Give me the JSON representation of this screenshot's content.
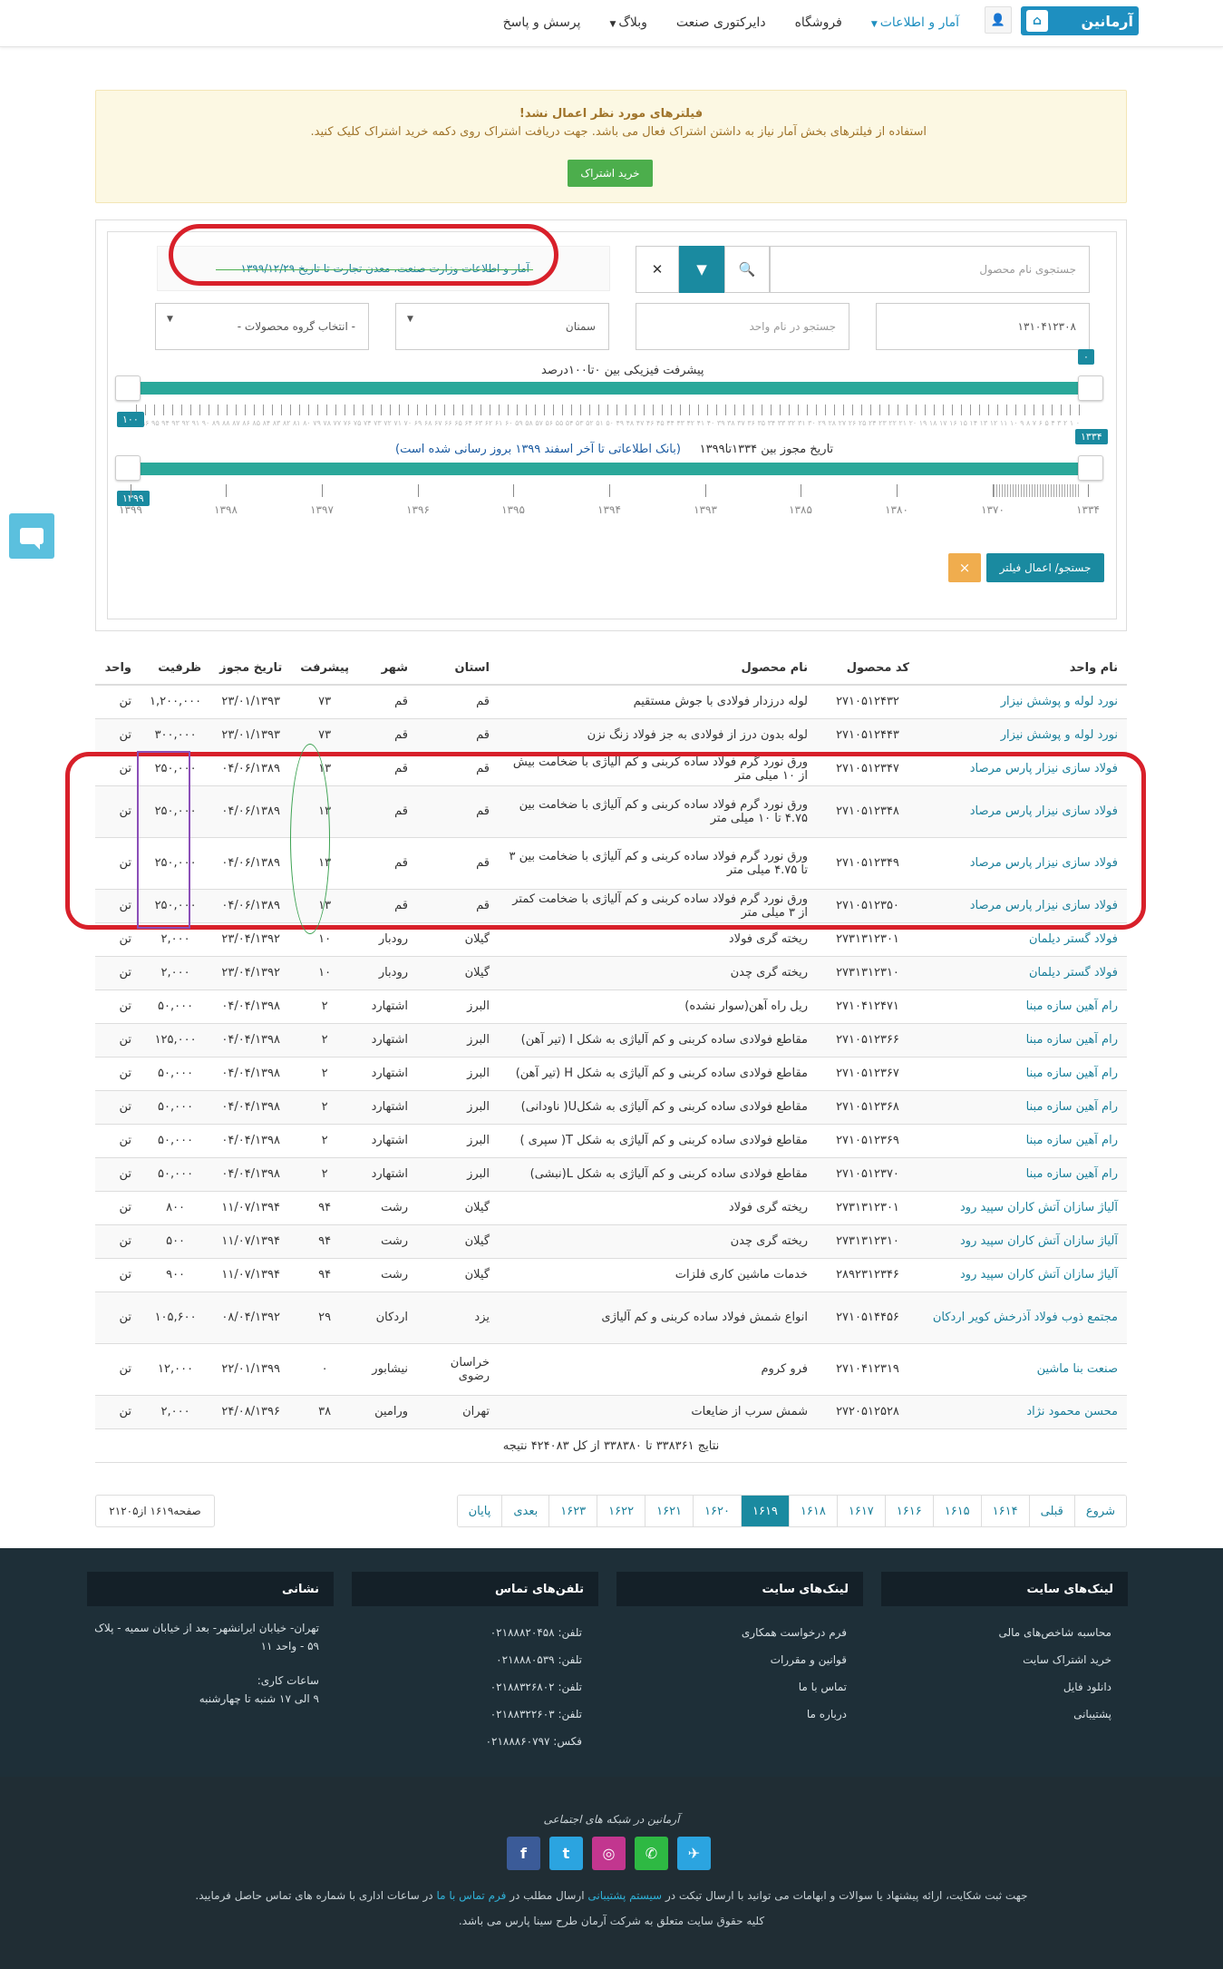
{
  "nav": {
    "logo_text": "آرمانین",
    "items": [
      {
        "label": "آمار و اطلاعات",
        "dropdown": true,
        "active": true
      },
      {
        "label": "فروشگاه",
        "dropdown": false,
        "active": false
      },
      {
        "label": "دایرکتوری صنعت",
        "dropdown": false,
        "active": false
      },
      {
        "label": "وبلاگ",
        "dropdown": true,
        "active": false
      },
      {
        "label": "پرسش و پاسخ",
        "dropdown": false,
        "active": false
      }
    ]
  },
  "alert": {
    "title": "فیلترهای مورد نظر اعمال نشد!",
    "text": "استفاده از فیلترهای بخش آمار نیاز به داشتن اشتراک فعال می باشد. جهت دریافت اشتراک روی دکمه خرید اشتراک کلیک کنید.",
    "button": "خرید اشتراک"
  },
  "filter": {
    "product_search_placeholder": "جستجوی نام محصول",
    "info_text": "آمار و اطلاعات وزارت صنعت، معدن تجارت تا تاریخ ۱۳۹۹/۱۲/۲۹",
    "code_value": "۱۳۱۰۴۱۲۳۰۸",
    "unit_search_placeholder": "جستجو در نام واحد",
    "province_value": "سمنان",
    "group_value": "- انتخاب گروه محصولات -",
    "progress_label": "پیشرفت فیزیکی بین ۰تا۱۰۰درصد",
    "progress_min_badge": "۰",
    "progress_max_badge": "۱۰۰",
    "progress_range": [
      0,
      100
    ],
    "date_label": "تاریخ مجوز بین ۱۳۳۴تا۱۳۹۹",
    "date_note": "(بانک اطلاعاتی تا آخر اسفند ۱۳۹۹ بروز رسانی شده است)",
    "date_min_badge": "۱۳۳۴",
    "date_max_badge": "۱۳۹۹",
    "date_range": [
      1334,
      1399
    ],
    "date_ticks": [
      "۱۳۳۴",
      "۱۳۷۰",
      "۱۳۸۰",
      "۱۳۸۵",
      "۱۳۹۳",
      "۱۳۹۴",
      "۱۳۹۵",
      "۱۳۹۶",
      "۱۳۹۷",
      "۱۳۹۸",
      "۱۳۹۹"
    ],
    "progress_tick_text": "۰ ۱ ۲ ۳ ۴ ۵ ۶ ۷ ۸ ۹ ۱۰ ۱۱ ۱۲ ۱۳ ۱۴ ۱۵ ۱۶ ۱۷ ۱۸ ۱۹ ۲۰ ۲۱ ۲۲ ۲۳ ۲۴ ۲۵ ۲۶ ۲۷ ۲۸ ۲۹ ۳۰ ۳۱ ۳۲ ۳۳ ۳۴ ۳۵ ۳۶ ۳۷ ۳۸ ۳۹ ۴۰ ۴۱ ۴۲ ۴۳ ۴۴ ۴۵ ۴۶ ۴۷ ۴۸ ۴۹ ۵۰ ۵۱ ۵۲ ۵۳ ۵۴ ۵۵ ۵۶ ۵۷ ۵۸ ۵۹ ۶۰ ۶۱ ۶۲ ۶۳ ۶۴ ۶۵ ۶۶ ۶۷ ۶۸ ۶۹ ۷۰ ۷۱ ۷۲ ۷۳ ۷۴ ۷۵ ۷۶ ۷۷ ۷۸ ۷۹ ۸۰ ۸۱ ۸۲ ۸۳ ۸۴ ۸۵ ۸۶ ۸۷ ۸۸ ۸۹ ۹۰ ۹۱ ۹۲ ۹۳ ۹۴ ۹۵ ۹۶ ۹۷ ۹۸ ۹۹ ۱۰۰",
    "search_button": "جستجو/ اعمال فیلتر",
    "clear_button": "×"
  },
  "table": {
    "headers": [
      "نام واحد",
      "کد محصول",
      "نام محصول",
      "استان",
      "شهر",
      "پیشرفت",
      "تاریخ مجوز",
      "ظرفیت",
      "واحد"
    ],
    "rows": [
      {
        "unit": "نورد لوله و پوشش نیزار",
        "code": "۲۷۱۰۵۱۲۴۳۲",
        "product": "لوله درزدار فولادی با جوش مستقیم",
        "province": "قم",
        "city": "قم",
        "progress": "۷۳",
        "date": "۲۳/۰۱/۱۳۹۳",
        "capacity": "۱,۲۰۰,۰۰۰",
        "measure": "تن",
        "tall": false
      },
      {
        "unit": "نورد لوله و پوشش نیزار",
        "code": "۲۷۱۰۵۱۲۴۴۳",
        "product": "لوله بدون درز از فولادی به جز فولاد زنگ نزن",
        "province": "قم",
        "city": "قم",
        "progress": "۷۳",
        "date": "۲۳/۰۱/۱۳۹۳",
        "capacity": "۳۰۰,۰۰۰",
        "measure": "تن",
        "tall": false
      },
      {
        "unit": "فولاد سازی نیزار پارس مرصاد",
        "code": "۲۷۱۰۵۱۲۳۴۷",
        "product": "ورق نورد گرم فولاد ساده کربنی و کم آلیاژی با ضخامت بیش از ۱۰ میلی متر",
        "province": "قم",
        "city": "قم",
        "progress": "۱۳",
        "date": "۰۴/۰۶/۱۳۸۹",
        "capacity": "۲۵۰,۰۰۰",
        "measure": "تن",
        "tall": false
      },
      {
        "unit": "فولاد سازی نیزار پارس مرصاد",
        "code": "۲۷۱۰۵۱۲۳۴۸",
        "product": "ورق نورد گرم فولاد ساده کربنی و کم آلیاژی با ضخامت بین ۴.۷۵ تا ۱۰ میلی متر",
        "province": "قم",
        "city": "قم",
        "progress": "۱۳",
        "date": "۰۴/۰۶/۱۳۸۹",
        "capacity": "۲۵۰,۰۰۰",
        "measure": "تن",
        "tall": true
      },
      {
        "unit": "فولاد سازی نیزار پارس مرصاد",
        "code": "۲۷۱۰۵۱۲۳۴۹",
        "product": "ورق نورد گرم فولاد ساده کربنی و کم آلیاژی با ضخامت بین ۳ تا ۴.۷۵ میلی متر",
        "province": "قم",
        "city": "قم",
        "progress": "۱۳",
        "date": "۰۴/۰۶/۱۳۸۹",
        "capacity": "۲۵۰,۰۰۰",
        "measure": "تن",
        "tall": true
      },
      {
        "unit": "فولاد سازی نیزار پارس مرصاد",
        "code": "۲۷۱۰۵۱۲۳۵۰",
        "product": "ورق نورد گرم فولاد ساده کربنی و کم آلیاژی با ضخامت کمتر از ۳ میلی متر",
        "province": "قم",
        "city": "قم",
        "progress": "۱۳",
        "date": "۰۴/۰۶/۱۳۸۹",
        "capacity": "۲۵۰,۰۰۰",
        "measure": "تن",
        "tall": false
      },
      {
        "unit": "فولاد گستر دیلمان",
        "code": "۲۷۳۱۳۱۲۳۰۱",
        "product": "ریخته گری فولاد",
        "province": "گیلان",
        "city": "رودبار",
        "progress": "۱۰",
        "date": "۲۳/۰۴/۱۳۹۲",
        "capacity": "۲,۰۰۰",
        "measure": "تن",
        "tall": false
      },
      {
        "unit": "فولاد گستر دیلمان",
        "code": "۲۷۳۱۳۱۲۳۱۰",
        "product": "ریخته گری چدن",
        "province": "گیلان",
        "city": "رودبار",
        "progress": "۱۰",
        "date": "۲۳/۰۴/۱۳۹۲",
        "capacity": "۲,۰۰۰",
        "measure": "تن",
        "tall": false
      },
      {
        "unit": "رام آهین سازه مبنا",
        "code": "۲۷۱۰۴۱۲۴۷۱",
        "product": "ریل راه آهن(سوار نشده)",
        "province": "البرز",
        "city": "اشتهارد",
        "progress": "۲",
        "date": "۰۴/۰۴/۱۳۹۸",
        "capacity": "۵۰,۰۰۰",
        "measure": "تن",
        "tall": false
      },
      {
        "unit": "رام آهین سازه مبنا",
        "code": "۲۷۱۰۵۱۲۳۶۶",
        "product": "مقاطع فولادی ساده کربنی و کم آلیاژی به شکل I (تیر آهن)",
        "province": "البرز",
        "city": "اشتهارد",
        "progress": "۲",
        "date": "۰۴/۰۴/۱۳۹۸",
        "capacity": "۱۲۵,۰۰۰",
        "measure": "تن",
        "tall": false
      },
      {
        "unit": "رام آهین سازه مبنا",
        "code": "۲۷۱۰۵۱۲۳۶۷",
        "product": "مقاطع فولادی ساده کربنی و کم آلیاژی به شکل H (تیر آهن)",
        "province": "البرز",
        "city": "اشتهارد",
        "progress": "۲",
        "date": "۰۴/۰۴/۱۳۹۸",
        "capacity": "۵۰,۰۰۰",
        "measure": "تن",
        "tall": false
      },
      {
        "unit": "رام آهین سازه مبنا",
        "code": "۲۷۱۰۵۱۲۳۶۸",
        "product": "مقاطع فولادی ساده کربنی و کم آلیاژی به شکلU( ناودانی)",
        "province": "البرز",
        "city": "اشتهارد",
        "progress": "۲",
        "date": "۰۴/۰۴/۱۳۹۸",
        "capacity": "۵۰,۰۰۰",
        "measure": "تن",
        "tall": false
      },
      {
        "unit": "رام آهین سازه مبنا",
        "code": "۲۷۱۰۵۱۲۳۶۹",
        "product": "مقاطع فولادی ساده کربنی و کم آلیاژی به شکل T( سپری )",
        "province": "البرز",
        "city": "اشتهارد",
        "progress": "۲",
        "date": "۰۴/۰۴/۱۳۹۸",
        "capacity": "۵۰,۰۰۰",
        "measure": "تن",
        "tall": false
      },
      {
        "unit": "رام آهین سازه مبنا",
        "code": "۲۷۱۰۵۱۲۳۷۰",
        "product": "مقاطع فولادی ساده کربنی و کم آلیاژی به شکل L(نبشی)",
        "province": "البرز",
        "city": "اشتهارد",
        "progress": "۲",
        "date": "۰۴/۰۴/۱۳۹۸",
        "capacity": "۵۰,۰۰۰",
        "measure": "تن",
        "tall": false
      },
      {
        "unit": "آلیاژ سازان آتش کاران سپید رود",
        "code": "۲۷۳۱۳۱۲۳۰۱",
        "product": "ریخته گری فولاد",
        "province": "گیلان",
        "city": "رشت",
        "progress": "۹۴",
        "date": "۱۱/۰۷/۱۳۹۴",
        "capacity": "۸۰۰",
        "measure": "تن",
        "tall": false
      },
      {
        "unit": "آلیاژ سازان آتش کاران سپید رود",
        "code": "۲۷۳۱۳۱۲۳۱۰",
        "product": "ریخته گری چدن",
        "province": "گیلان",
        "city": "رشت",
        "progress": "۹۴",
        "date": "۱۱/۰۷/۱۳۹۴",
        "capacity": "۵۰۰",
        "measure": "تن",
        "tall": false
      },
      {
        "unit": "آلیاژ سازان آتش کاران سپید رود",
        "code": "۲۸۹۲۳۱۲۳۴۶",
        "product": "خدمات ماشین کاری فلزات",
        "province": "گیلان",
        "city": "رشت",
        "progress": "۹۴",
        "date": "۱۱/۰۷/۱۳۹۴",
        "capacity": "۹۰۰",
        "measure": "تن",
        "tall": false
      },
      {
        "unit": "مجتمع ذوب فولاد آذرخش کویر اردکان",
        "code": "۲۷۱۰۵۱۴۴۵۶",
        "product": "انواع شمش فولاد ساده کربنی و کم آلیاژی",
        "province": "یزد",
        "city": "اردکان",
        "progress": "۲۹",
        "date": "۰۸/۰۴/۱۳۹۲",
        "capacity": "۱۰۵,۶۰۰",
        "measure": "تن",
        "tall": true
      },
      {
        "unit": "صنعت بنا ماشین",
        "code": "۲۷۱۰۴۱۲۳۱۹",
        "product": "فرو کروم",
        "province": "خراسان رضوی",
        "city": "نیشابور",
        "progress": "۰",
        "date": "۲۲/۰۱/۱۳۹۹",
        "capacity": "۱۲,۰۰۰",
        "measure": "تن",
        "tall": true
      },
      {
        "unit": "محسن محمود نژاد",
        "code": "۲۷۲۰۵۱۲۵۲۸",
        "product": "شمش سرب از ضایعات",
        "province": "تهران",
        "city": "ورامین",
        "progress": "۳۸",
        "date": "۲۴/۰۸/۱۳۹۶",
        "capacity": "۲,۰۰۰",
        "measure": "تن",
        "tall": false
      }
    ],
    "result_count": "نتایج ۳۳۸۳۶۱ تا ۳۳۸۳۸۰ از کل ۴۲۴۰۸۳ نتیجه"
  },
  "pagination": {
    "pages": [
      "شروع",
      "قبلی",
      "۱۶۱۴",
      "۱۶۱۵",
      "۱۶۱۶",
      "۱۶۱۷",
      "۱۶۱۸",
      "۱۶۱۹",
      "۱۶۲۰",
      "۱۶۲۱",
      "۱۶۲۲",
      "۱۶۲۳",
      "بعدی",
      "پایان"
    ],
    "active": "۱۶۱۹",
    "page_info": "صفحه۱۶۱۹ از۲۱۲۰۵"
  },
  "footer": {
    "col1": {
      "title": "لینک‌های سایت",
      "items": [
        "محاسبه شاخص‌های مالی",
        "خرید اشتراک سایت",
        "دانلود فایل",
        "پشتیبانی"
      ]
    },
    "col2": {
      "title": "لینک‌های سایت",
      "items": [
        "فرم درخواست همکاری",
        "قوانین و مقررات",
        "تماس با ما",
        "درباره ما"
      ]
    },
    "col3": {
      "title": "تلفن‌های تماس",
      "items": [
        "تلفن: ۰۲۱۸۸۸۲۰۴۵۸",
        "تلفن: ۰۲۱۸۸۸۰۵۳۹",
        "تلفن: ۰۲۱۸۸۳۲۶۸۰۲",
        "تلفن: ۰۲۱۸۸۳۲۲۶۰۳",
        "فکس: ۰۲۱۸۸۸۶۰۷۹۷"
      ]
    },
    "col4": {
      "title": "نشانی",
      "address": "تهران- خیابان ایرانشهر- بعد از خیابان سمیه - پلاک ۵۹ - واحد ۱۱",
      "hours_title": "ساعات کاری:",
      "hours": "۹ الی ۱۷ شنبه تا چهارشنبه"
    },
    "social_title": "آرمانین در شبکه های اجتماعی",
    "complaint_pre": "جهت ثبت شکایت، ارائه پیشنهاد یا سوالات و ابهامات می توانید با ارسال تیکت در",
    "complaint_link1": "سیستم پشتیبانی",
    "complaint_mid": "ارسال مطلب در",
    "complaint_link2": "فرم تماس با ما",
    "complaint_post": "در ساعات اداری با شماره های تماس حاصل فرمایید.",
    "copyright": "کلیه حقوق سایت متعلق به شرکت آرمان طرح سینا پارس می باشد."
  },
  "colors": {
    "teal": "#1a8aa0",
    "slider": "#2aa89a",
    "annotation_red": "#d8202a",
    "annotation_purple": "#8b4fb8",
    "annotation_green": "#3aa150"
  }
}
